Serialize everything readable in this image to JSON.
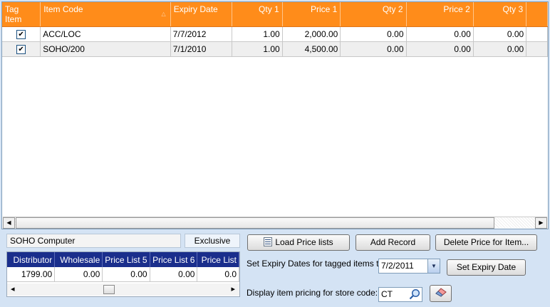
{
  "grid": {
    "columns": [
      {
        "label": "Tag Item"
      },
      {
        "label": "Item Code"
      },
      {
        "label": "Expiry Date"
      },
      {
        "label": "Qty 1"
      },
      {
        "label": "Price 1"
      },
      {
        "label": "Qty 2"
      },
      {
        "label": "Price 2"
      },
      {
        "label": "Qty 3"
      }
    ],
    "rows": [
      {
        "tagged": "✔",
        "item_code": "ACC/LOC",
        "expiry": "7/7/2012",
        "qty1": "1.00",
        "price1": "2,000.00",
        "qty2": "0.00",
        "price2": "0.00",
        "qty3": "0.00"
      },
      {
        "tagged": "✔",
        "item_code": "SOHO/200",
        "expiry": "7/1/2010",
        "qty1": "1.00",
        "price1": "4,500.00",
        "qty2": "0.00",
        "price2": "0.00",
        "qty3": "0.00"
      }
    ],
    "scroll_left": "◀",
    "scroll_right": "▶"
  },
  "item_description": "SOHO Computer",
  "tax_mode": "Exclusive",
  "buttons": {
    "load_price_lists": "Load Price lists",
    "add_record": "Add Record",
    "delete_price": "Delete Price for Item...",
    "set_expiry": "Set Expiry Date"
  },
  "price_grid": {
    "headers": [
      "Distributor",
      "Wholesale",
      "Price List 5",
      "Price List 6",
      "Price List"
    ],
    "values": [
      "1799.00",
      "0.00",
      "0.00",
      "0.00",
      "0.0"
    ],
    "scroll_left": "◂",
    "scroll_right": "▸"
  },
  "expiry": {
    "label": "Set Expiry Dates for tagged items to",
    "value": "7/2/2011"
  },
  "store": {
    "label": "Display item pricing for store code:",
    "value": "CT"
  },
  "icons": {
    "dropdown": "▼",
    "sort": "△"
  }
}
